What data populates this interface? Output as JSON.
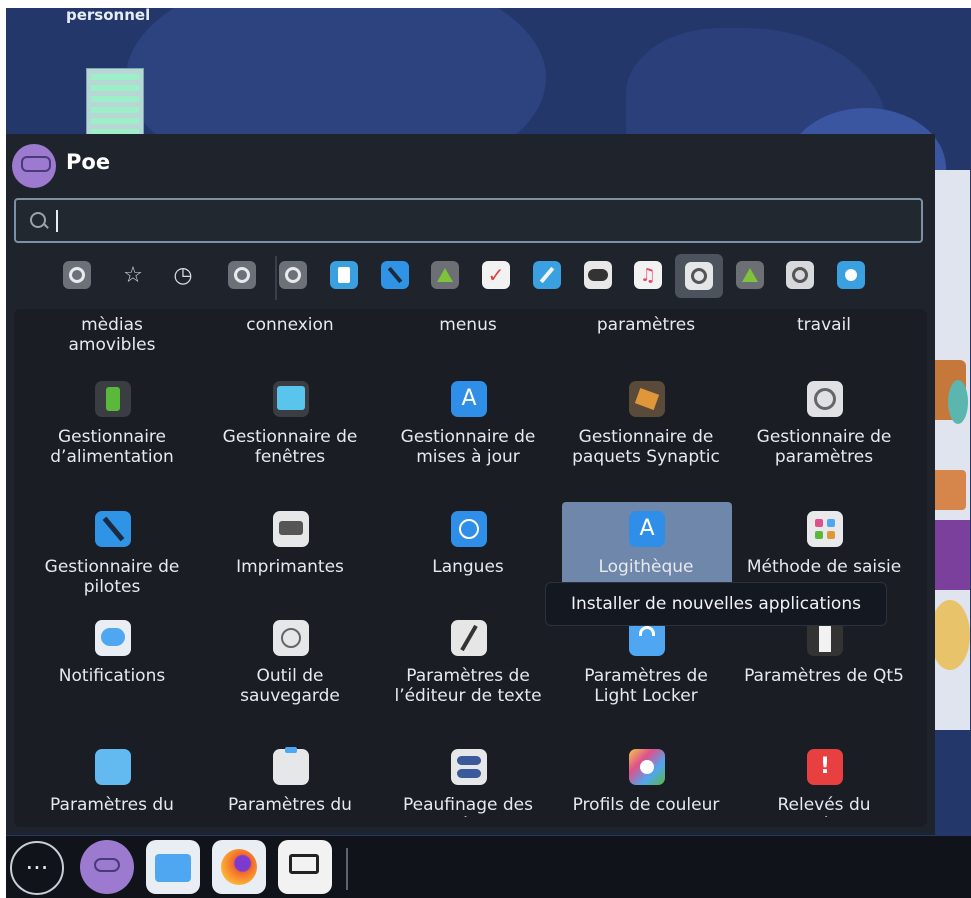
{
  "desktop": {
    "folder_label": "personnel"
  },
  "user": {
    "name": "Poe"
  },
  "search": {
    "value": "",
    "placeholder": ""
  },
  "categories": [
    {
      "name": "all-applications",
      "icon": "gear-icon"
    },
    {
      "name": "favorites",
      "icon": "star-icon",
      "glyph": "☆"
    },
    {
      "name": "recent",
      "icon": "clock-icon",
      "glyph": "◷"
    },
    {
      "name": "settings",
      "icon": "gear-icon"
    },
    {
      "name": "system",
      "icon": "gear-icon"
    },
    {
      "name": "office",
      "icon": "document-icon"
    },
    {
      "name": "development",
      "icon": "hammer-icon"
    },
    {
      "name": "education",
      "icon": "flask-icon"
    },
    {
      "name": "productivity",
      "icon": "checkmark-icon"
    },
    {
      "name": "internet",
      "icon": "compass-icon"
    },
    {
      "name": "games",
      "icon": "gamepad-icon"
    },
    {
      "name": "multimedia",
      "icon": "music-icon"
    },
    {
      "name": "settings-selected",
      "icon": "gear-icon"
    },
    {
      "name": "science",
      "icon": "flask-icon"
    },
    {
      "name": "other",
      "icon": "gear-icon"
    },
    {
      "name": "accessories",
      "icon": "tools-icon"
    }
  ],
  "top_row_labels": [
    "mèdias\namovibles",
    "connexion",
    "menus",
    "paramètres",
    "travail"
  ],
  "apps": [
    {
      "label": "Gestionnaire d’alimentation",
      "icon": "battery-icon",
      "color": "#5ab83a"
    },
    {
      "label": "Gestionnaire de fenêtres",
      "icon": "window-icon",
      "color": "#59c4ec"
    },
    {
      "label": "Gestionnaire de mises à jour",
      "icon": "app-store-icon",
      "color": "#2f8fe8"
    },
    {
      "label": "Gestionnaire de paquets Synaptic",
      "icon": "package-icon",
      "color": "#e0973a"
    },
    {
      "label": "Gestionnaire de paramètres",
      "icon": "gear-icon",
      "color": "#dfe1e4"
    },
    {
      "label": "Gestionnaire de pilotes",
      "icon": "hammer-icon",
      "color": "#2f94e6"
    },
    {
      "label": "Imprimantes",
      "icon": "printer-icon",
      "color": "#e6e7e9"
    },
    {
      "label": "Langues",
      "icon": "globe-icon",
      "color": "#2f8fe8"
    },
    {
      "label": "Logithèque",
      "icon": "app-store-icon",
      "color": "#2f8fe8"
    },
    {
      "label": "Méthode de saisie",
      "icon": "keyboard-icon",
      "color": "#e9e9ec"
    },
    {
      "label": "Notifications",
      "icon": "chat-bubble-icon",
      "color": "#4ea7f0"
    },
    {
      "label": "Outil de sauvegarde",
      "icon": "clock-icon",
      "color": "#e6e7e9"
    },
    {
      "label": "Paramètres de l’éditeur de texte",
      "icon": "pencil-icon",
      "color": "#e6e6e6"
    },
    {
      "label": "Paramètres de Light Locker",
      "icon": "lock-icon",
      "color": "#4ea7f0"
    },
    {
      "label": "Paramètres de Qt5",
      "icon": "tuxedo-icon",
      "color": "#333333"
    },
    {
      "label": "Paramètres du bureau",
      "icon": "folder-icon",
      "color": "#62baf0"
    },
    {
      "label": "Paramètres du gestionnaire de",
      "icon": "clipboard-icon",
      "color": "#e6e7e9"
    },
    {
      "label": "Peaufinage des fenêtres",
      "icon": "toggle-icon",
      "color": "#e6e7e9"
    },
    {
      "label": "Profils de couleur",
      "icon": "color-profile-icon",
      "color": "#e0508a"
    },
    {
      "label": "Relevés du système",
      "icon": "alert-icon",
      "color": "#e84040"
    }
  ],
  "tooltip": {
    "text": "Installer de nouvelles applications"
  },
  "dock": [
    {
      "name": "app-menu",
      "icon": "dots-icon",
      "glyph": "···"
    },
    {
      "name": "poe-app",
      "icon": "octopus-icon"
    },
    {
      "name": "files",
      "icon": "folder-icon"
    },
    {
      "name": "firefox",
      "icon": "firefox-icon"
    },
    {
      "name": "display-settings",
      "icon": "monitor-icon"
    }
  ]
}
